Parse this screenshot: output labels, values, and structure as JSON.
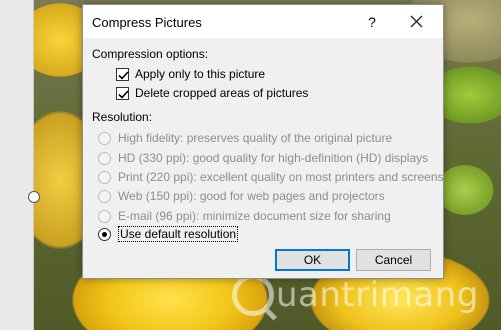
{
  "dialog": {
    "title": "Compress Pictures",
    "help_glyph": "?",
    "compression_label": "Compression options:",
    "compression_options": [
      {
        "label": "Apply only to this picture",
        "checked": true
      },
      {
        "label": "Delete cropped areas of pictures",
        "checked": true
      }
    ],
    "resolution_label": "Resolution:",
    "resolution_options": [
      {
        "label": "High fidelity: preserves quality of the original picture",
        "selected": false,
        "enabled": false
      },
      {
        "label": "HD (330 ppi): good quality for high-definition (HD) displays",
        "selected": false,
        "enabled": false
      },
      {
        "label": "Print (220 ppi): excellent quality on most printers and screens",
        "selected": false,
        "enabled": false
      },
      {
        "label": "Web (150 ppi): good for web pages and projectors",
        "selected": false,
        "enabled": false
      },
      {
        "label": "E-mail (96 ppi): minimize document size for sharing",
        "selected": false,
        "enabled": false
      },
      {
        "label": "Use default resolution",
        "selected": true,
        "enabled": true
      }
    ],
    "ok_label": "OK",
    "cancel_label": "Cancel"
  },
  "watermark": {
    "text": "uantrimang"
  },
  "colors": {
    "accent": "#0078d7",
    "dialog_bg": "#f0f0f0",
    "disabled_text": "#8d8d8d"
  }
}
